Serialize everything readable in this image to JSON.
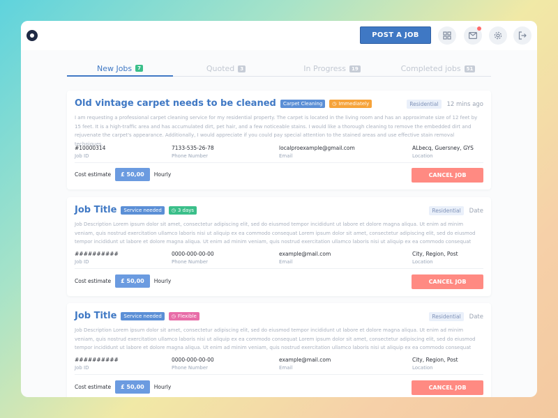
{
  "header": {
    "post_label": "POST A JOB",
    "icons": [
      "location-pin-icon",
      "grid-icon",
      "mail-icon",
      "settings-icon",
      "logout-icon"
    ]
  },
  "tabs": [
    {
      "label": "New Jobs",
      "count": "7"
    },
    {
      "label": "Quoted",
      "count": "3"
    },
    {
      "label": "In Progress",
      "count": "19"
    },
    {
      "label": "Completed jobs",
      "count": "51"
    }
  ],
  "cards": [
    {
      "title": "Old vintage carpet needs to be cleaned",
      "tag1": "Carpet Cleaning",
      "tag2": "Immediately",
      "type": "Residential",
      "time": "12 mins ago",
      "desc": "I am requesting a professional carpet cleaning service for my residential property. The carpet is located in the living room and has an approximate size of 12 feet by 15 feet. It is a high-traffic area and has accumulated dirt, pet hair, and a few noticeable stains. I would like a thorough cleaning to remove the embedded dirt and rejuvenate the carpet's appearance. Additionally, I would appreciate if you could pay special attention to the stained areas and use effective stain removal techniques.",
      "job_id": "#10000314",
      "phone": "7133-535-26-78",
      "email": "localproexample@gmail.com",
      "location": "ALbecq, Guersney, GYS",
      "price": "£ 50,00"
    },
    {
      "title": "Job Title",
      "tag1": "Service needed",
      "tag2": "3 days",
      "type": "Residential",
      "time": "Date",
      "desc": "Job Description Lorem ipsum dolor sit amet, consectetur adipiscing elit, sed do eiusmod tempor incididunt ut labore et dolore magna aliqua. Ut enim ad minim veniam, quis nostrud exercitation ullamco laboris nisi ut aliquip ex ea commodo consequat Lorem ipsum dolor sit amet, consectetur adipiscing elit, sed do eiusmod tempor incididunt ut labore et dolore magna aliqua. Ut enim ad minim veniam, quis nostrud exercitation ullamco laboris nisi ut aliquip ex ea commodo consequat",
      "job_id": "##########",
      "phone": "0000-000-00-00",
      "email": "example@mail.com",
      "location": "City, Region, Post",
      "price": "£ 50,00"
    },
    {
      "title": "Job Title",
      "tag1": "Service needed",
      "tag2": "Flexible",
      "type": "Residential",
      "time": "Date",
      "desc": "Job Description Lorem ipsum dolor sit amet, consectetur adipiscing elit, sed do eiusmod tempor incididunt ut labore et dolore magna aliqua. Ut enim ad minim veniam, quis nostrud exercitation ullamco laboris nisi ut aliquip ex ea commodo consequat Lorem ipsum dolor sit amet, consectetur adipiscing elit, sed do eiusmod tempor incididunt ut labore et dolore magna aliqua. Ut enim ad minim veniam, quis nostrud exercitation ullamco laboris nisi ut aliquip ex ea commodo consequat",
      "job_id": "##########",
      "phone": "0000-000-00-00",
      "email": "example@mail.com",
      "location": "City, Region, Post",
      "price": "£ 50,00"
    }
  ],
  "labels": {
    "job_id": "Job ID",
    "phone": "Phone Number",
    "email": "Email",
    "location": "Location",
    "cost": "Cost estimate",
    "hourly": "Hourly",
    "cancel": "CANCEL JOB"
  },
  "colors": {
    "accent": "#3f78c4",
    "cancel": "#ff8a82",
    "tag_orange": "#f6a33a",
    "tag_green": "#3bbf8a",
    "tag_pink": "#e86da8"
  }
}
